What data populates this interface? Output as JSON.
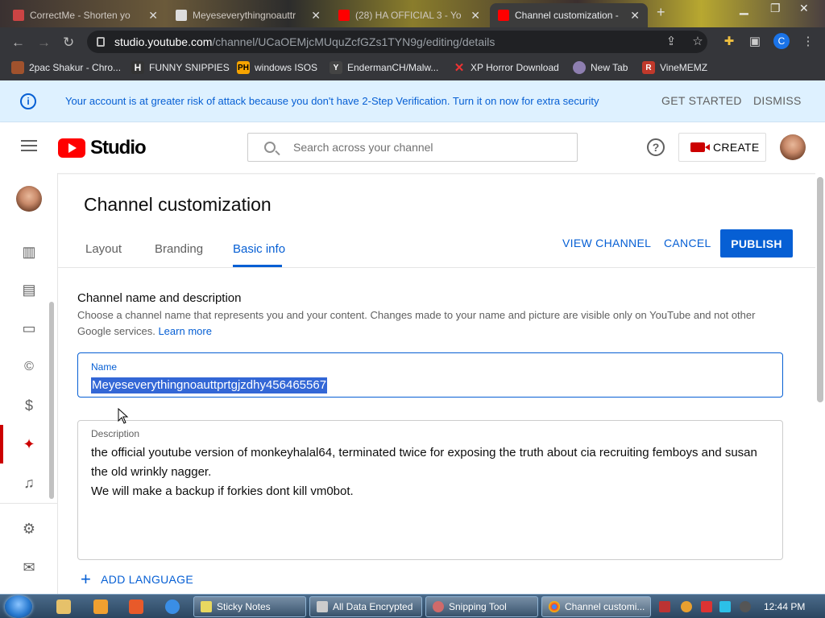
{
  "browser": {
    "tabs": [
      {
        "title": "CorrectMe - Shorten yo"
      },
      {
        "title": "Meyeseverythingnoauttr"
      },
      {
        "title": "(28) HA OFFICIAL 3 - Yo"
      },
      {
        "title": "Channel customization -"
      }
    ],
    "url_domain": "studio.youtube.com",
    "url_path": "/channel/UCaOEMjcMUquZcfGZs1TYN9g/editing/details",
    "profile_initial": "C",
    "bookmarks": [
      {
        "label": "2pac Shakur - Chro..."
      },
      {
        "label": "FUNNY SNIPPIES"
      },
      {
        "label": "windows ISOS"
      },
      {
        "label": "EndermanCH/Malw..."
      },
      {
        "label": "XP Horror Download"
      },
      {
        "label": "New Tab"
      },
      {
        "label": "VineMEMZ"
      }
    ]
  },
  "banner": {
    "message": "Your account is at greater risk of attack because you don't have 2-Step Verification. Turn it on now for extra security",
    "get_started": "GET STARTED",
    "dismiss": "DISMISS"
  },
  "header": {
    "logo_text": "Studio",
    "search_placeholder": "Search across your channel",
    "create_label": "CREATE"
  },
  "sidebar": {
    "icons": [
      "analytics-icon",
      "comments-icon",
      "subtitles-icon",
      "copyright-icon",
      "monetization-icon",
      "customization-icon",
      "audio-library-icon",
      "settings-icon",
      "feedback-icon"
    ]
  },
  "page": {
    "title": "Channel customization",
    "tabs": [
      "Layout",
      "Branding",
      "Basic info"
    ],
    "active_tab": "Basic info",
    "view_channel": "VIEW CHANNEL",
    "cancel": "CANCEL",
    "publish": "PUBLISH",
    "section_title": "Channel name and description",
    "section_desc": "Choose a channel name that represents you and your content. Changes made to your name and picture are visible only on YouTube and not other Google services.",
    "learn_more": "Learn more",
    "name_label": "Name",
    "name_value": "Meyeseverythingnoauttprtgjzdhy456465567",
    "description_label": "Description",
    "description_line1": "the official youtube version of monkeyhalal64, terminated twice for exposing the truth about cia recruiting femboys and susan the old wrinkly nagger.",
    "description_line2": "We will make a backup if forkies dont kill vm0bot.",
    "add_language": "ADD LANGUAGE"
  },
  "taskbar": {
    "items": [
      {
        "label": "Sticky Notes"
      },
      {
        "label": "All Data Encrypted"
      },
      {
        "label": "Snipping Tool"
      },
      {
        "label": "Channel customi..."
      }
    ],
    "clock": "12:44 PM"
  },
  "colors": {
    "accent": "#065fd4",
    "brand_red": "#ff0000",
    "banner_bg": "#def1ff"
  }
}
